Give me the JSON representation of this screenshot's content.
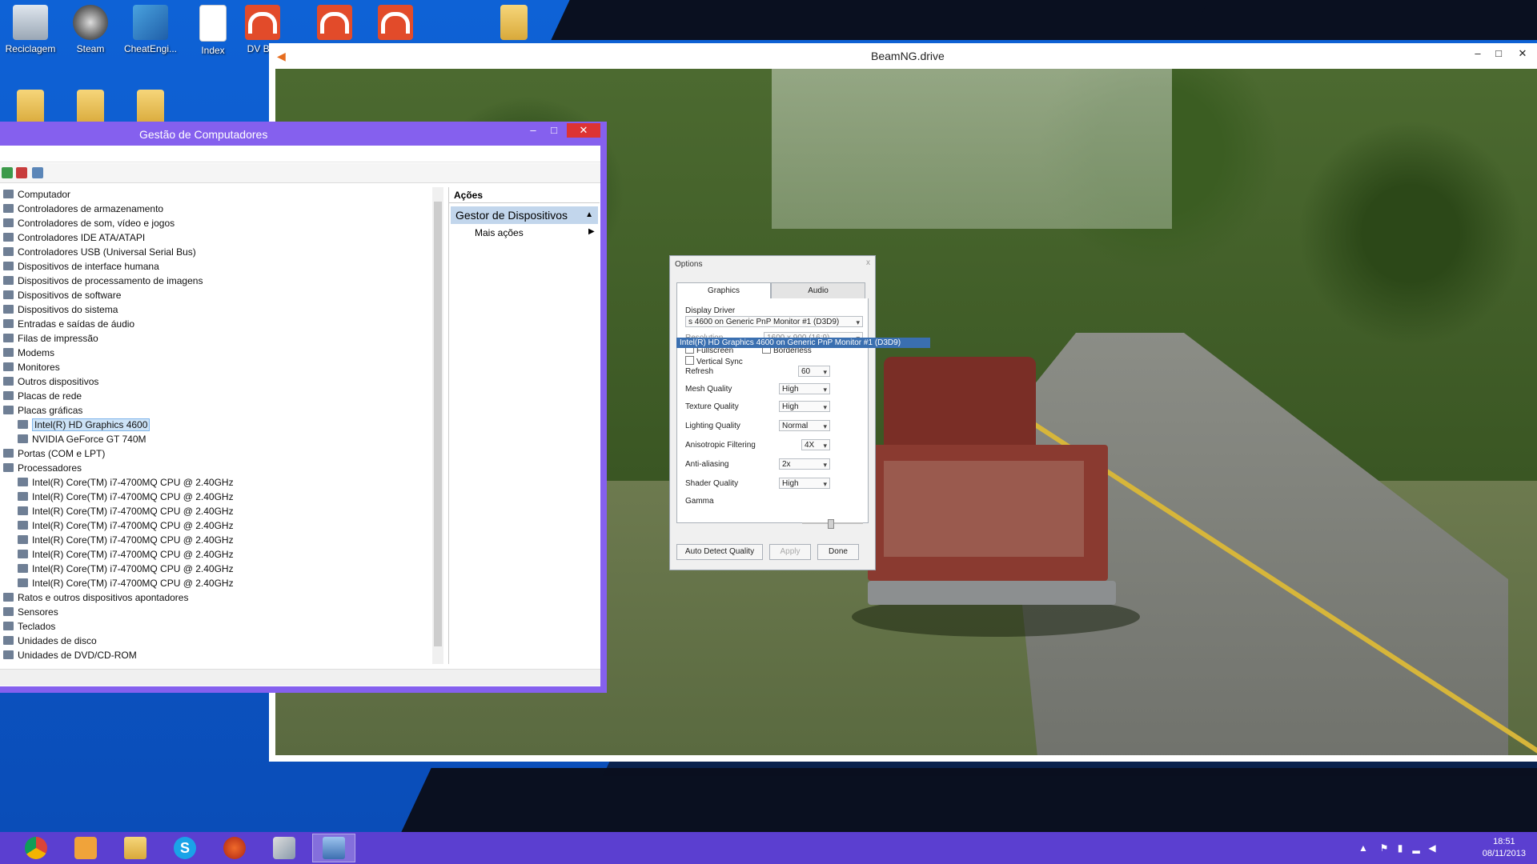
{
  "desktop": {
    "icons": [
      {
        "label": "Reciclagem"
      },
      {
        "label": "Steam"
      },
      {
        "label": "CheatEngi..."
      },
      {
        "label": "Index"
      },
      {
        "label": "DV Bor"
      }
    ]
  },
  "beamng": {
    "title": "BeamNG.drive",
    "minimize": "–",
    "maximize": "□",
    "close": "✕"
  },
  "options": {
    "title": "Options",
    "close": "x",
    "tabs": [
      "Graphics",
      "Audio"
    ],
    "display_driver_label": "Display Driver",
    "display_driver_value": "s 4600 on Generic PnP Monitor #1 (D3D9)",
    "dropdown_item": "Intel(R) HD Graphics 4600 on Generic PnP Monitor #1 (D3D9)",
    "resolution_label": "Resolution",
    "resolution_value": "1600 x 900 (16:9)",
    "fullscreen_label": "Fullscreen",
    "borderless_label": "Borderless",
    "vsync_label": "Vertical Sync",
    "refresh_label": "Refresh",
    "refresh_value": "60",
    "settings": [
      {
        "label": "Mesh Quality",
        "value": "High"
      },
      {
        "label": "Texture Quality",
        "value": "High"
      },
      {
        "label": "Lighting Quality",
        "value": "Normal"
      },
      {
        "label": "Anisotropic Filtering",
        "value": "4X"
      },
      {
        "label": "Anti-aliasing",
        "value": "2x"
      },
      {
        "label": "Shader Quality",
        "value": "High"
      }
    ],
    "gamma_label": "Gamma",
    "btn_auto": "Auto Detect Quality",
    "btn_apply": "Apply",
    "btn_done": "Done"
  },
  "compmgmt": {
    "title": "Gestão de Computadores",
    "minimize": "–",
    "maximize": "□",
    "close": "✕",
    "tree": [
      "Computador",
      "Controladores de armazenamento",
      "Controladores de som, vídeo e jogos",
      "Controladores IDE ATA/ATAPI",
      "Controladores USB (Universal Serial Bus)",
      "Dispositivos de interface humana",
      "Dispositivos de processamento de imagens",
      "Dispositivos de software",
      "Dispositivos do sistema",
      "Entradas e saídas de áudio",
      "Filas de impressão",
      "Modems",
      "Monitores",
      "Outros dispositivos",
      "Placas de rede",
      "Placas gráficas",
      "Intel(R) HD Graphics 4600",
      "NVIDIA GeForce GT 740M",
      "Portas (COM e LPT)",
      "Processadores",
      "Intel(R) Core(TM) i7-4700MQ CPU @ 2.40GHz",
      "Intel(R) Core(TM) i7-4700MQ CPU @ 2.40GHz",
      "Intel(R) Core(TM) i7-4700MQ CPU @ 2.40GHz",
      "Intel(R) Core(TM) i7-4700MQ CPU @ 2.40GHz",
      "Intel(R) Core(TM) i7-4700MQ CPU @ 2.40GHz",
      "Intel(R) Core(TM) i7-4700MQ CPU @ 2.40GHz",
      "Intel(R) Core(TM) i7-4700MQ CPU @ 2.40GHz",
      "Intel(R) Core(TM) i7-4700MQ CPU @ 2.40GHz",
      "Ratos e outros dispositivos apontadores",
      "Sensores",
      "Teclados",
      "Unidades de disco",
      "Unidades de DVD/CD-ROM"
    ],
    "actions_header": "Ações",
    "actions_selected": "Gestor de Dispositivos",
    "actions_more": "Mais ações"
  },
  "taskbar": {
    "apps": [
      "chrome-icon",
      "media-player-icon",
      "file-explorer-icon",
      "skype-icon",
      "network-app-icon",
      "paint-icon",
      "computer-management-icon"
    ],
    "time": "18:51",
    "date": "08/11/2013"
  },
  "colors": {
    "taskbar": "#5b3fd0",
    "window_frame": "#8560ee",
    "close_red": "#d33333",
    "selection": "#3a6fb0"
  }
}
